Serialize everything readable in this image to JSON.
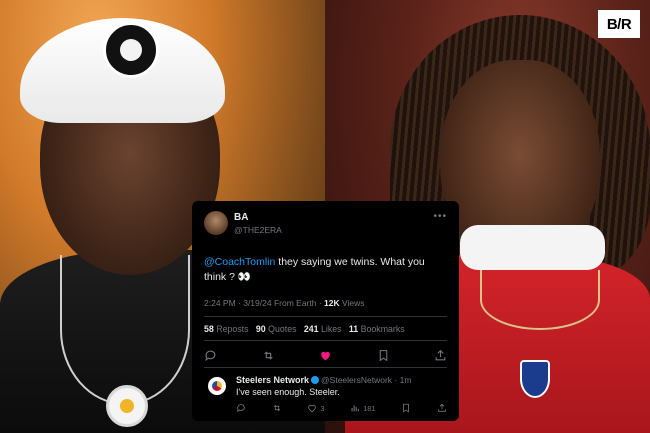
{
  "brand": {
    "logo_text": "B/R"
  },
  "tweet": {
    "author_name": "BA",
    "author_handle": "@THE2ERA",
    "more_icon": "more-horizontal-icon",
    "mention": "@CoachTomlin",
    "body_text": " they saying we twins. What you think ? 👀",
    "time": "2:24 PM",
    "date": "3/19/24",
    "source": "From Earth",
    "views_count": "12K",
    "views_label": "Views",
    "reposts_count": "58",
    "reposts_label": "Reposts",
    "quotes_count": "90",
    "quotes_label": "Quotes",
    "likes_count": "241",
    "likes_label": "Likes",
    "bookmarks_count": "11",
    "bookmarks_label": "Bookmarks",
    "like_color": "#f91880"
  },
  "reply": {
    "author_name": "Steelers Network",
    "author_handle": "@SteelersNetwork",
    "time_ago": "1m",
    "text": "I've seen enough. Steeler.",
    "likes": "3",
    "views": "181"
  }
}
